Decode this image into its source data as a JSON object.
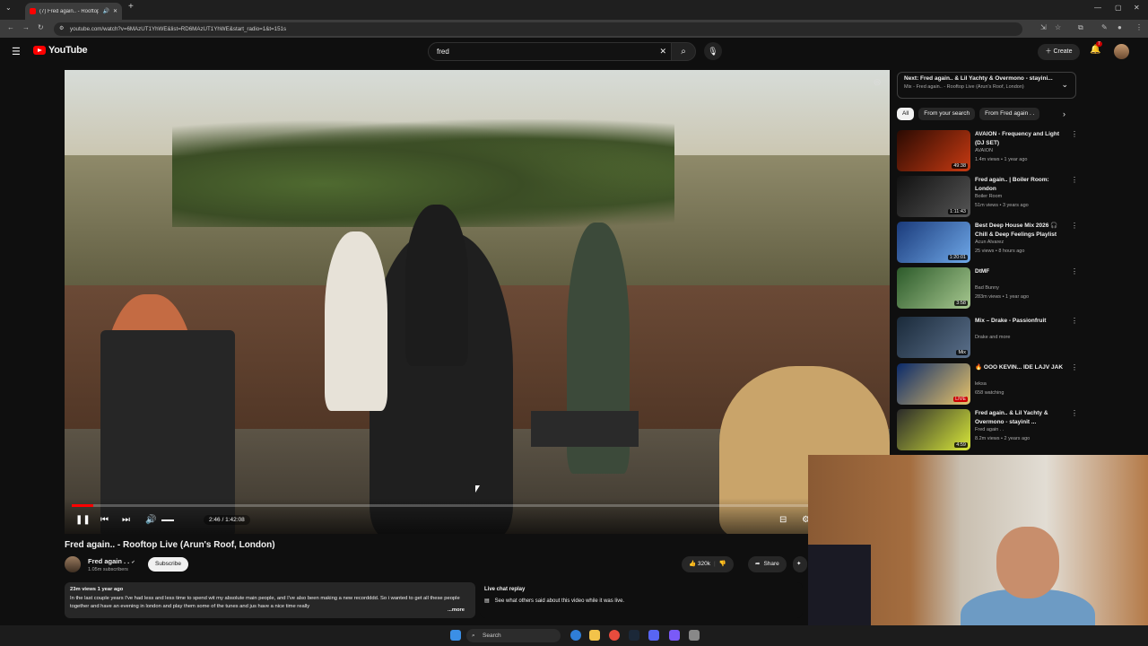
{
  "browser": {
    "tab_title": "(7) Fred again.. - Rooftop Li",
    "url": "youtube.com/watch?v=6MAzUT1YhWE&list=RD6MAzUT1YhWE&start_radio=1&t=151s"
  },
  "header": {
    "logo_text": "YouTube",
    "search_value": "fred",
    "create_label": "Create",
    "notif_count": "7"
  },
  "player": {
    "time": "2:46 / 1:42:08",
    "progress_fraction": 0.027,
    "volume_fraction": 0.3
  },
  "video": {
    "title": "Fred again.. - Rooftop Live (Arun's Roof, London)",
    "channel": "Fred again . .",
    "subscribers": "1.05m subscribers",
    "subscribe_label": "Subscribe",
    "likes": "320k",
    "share_label": "Share"
  },
  "description": {
    "meta": "23m views  1 year ago",
    "text": "In the last couple years I've had less and less time to spend wit my absolute main people, and I've also been making a new recordddd. So i wanted to get all these people together and have an evening in london and play them some of the tunes and jus have a nice time really",
    "more": "...more"
  },
  "live_chat": {
    "title": "Live chat replay",
    "text": "See what others said about this video while it was live."
  },
  "sidebar": {
    "next_title": "Next: Fred again.. & Lil Yachty & Overmono - stayini...",
    "next_sub": "Mix - Fred again.. - Rooftop Live (Arun's Roof, London)",
    "chips": [
      "All",
      "From your search",
      "From Fred again . ."
    ],
    "recs": [
      {
        "title": "AVAION - Frequency and Light (DJ SET)",
        "channel": "AVAION",
        "meta": "1.4m views • 1 year ago",
        "duration": "49:38"
      },
      {
        "title": "Fred again.. | Boiler Room: London",
        "channel": "Boiler Room",
        "meta": "51m views • 3 years ago",
        "duration": "1:11:43"
      },
      {
        "title": "Best Deep House Mix 2026 🎧 Chill & Deep Feelings Playlist",
        "channel": "Acun Alvarez",
        "meta": "25 views • 8 hours ago",
        "duration": "1:20:01"
      },
      {
        "title": "DtMF",
        "channel": "Bad Bunny",
        "meta": "283m views • 1 year ago",
        "duration": "3:58"
      },
      {
        "title": "Mix – Drake - Passionfruit",
        "channel": "Drake and more",
        "meta": "",
        "duration": "Mix"
      },
      {
        "title": "🔥 OOO KEVIN... IDE LAJV JAK",
        "channel": "leksa",
        "meta": "658 watching",
        "duration": "LIVE"
      },
      {
        "title": "Fred again.. & Lil Yachty & Overmono - stayinit ...",
        "channel": "Fred again . .",
        "meta": "8.2m views • 2 years ago",
        "duration": "4:59"
      }
    ]
  },
  "taskbar": {
    "search_label": "Search"
  },
  "colors": {
    "accent": "#ff0000",
    "background": "#0f0f0f"
  }
}
